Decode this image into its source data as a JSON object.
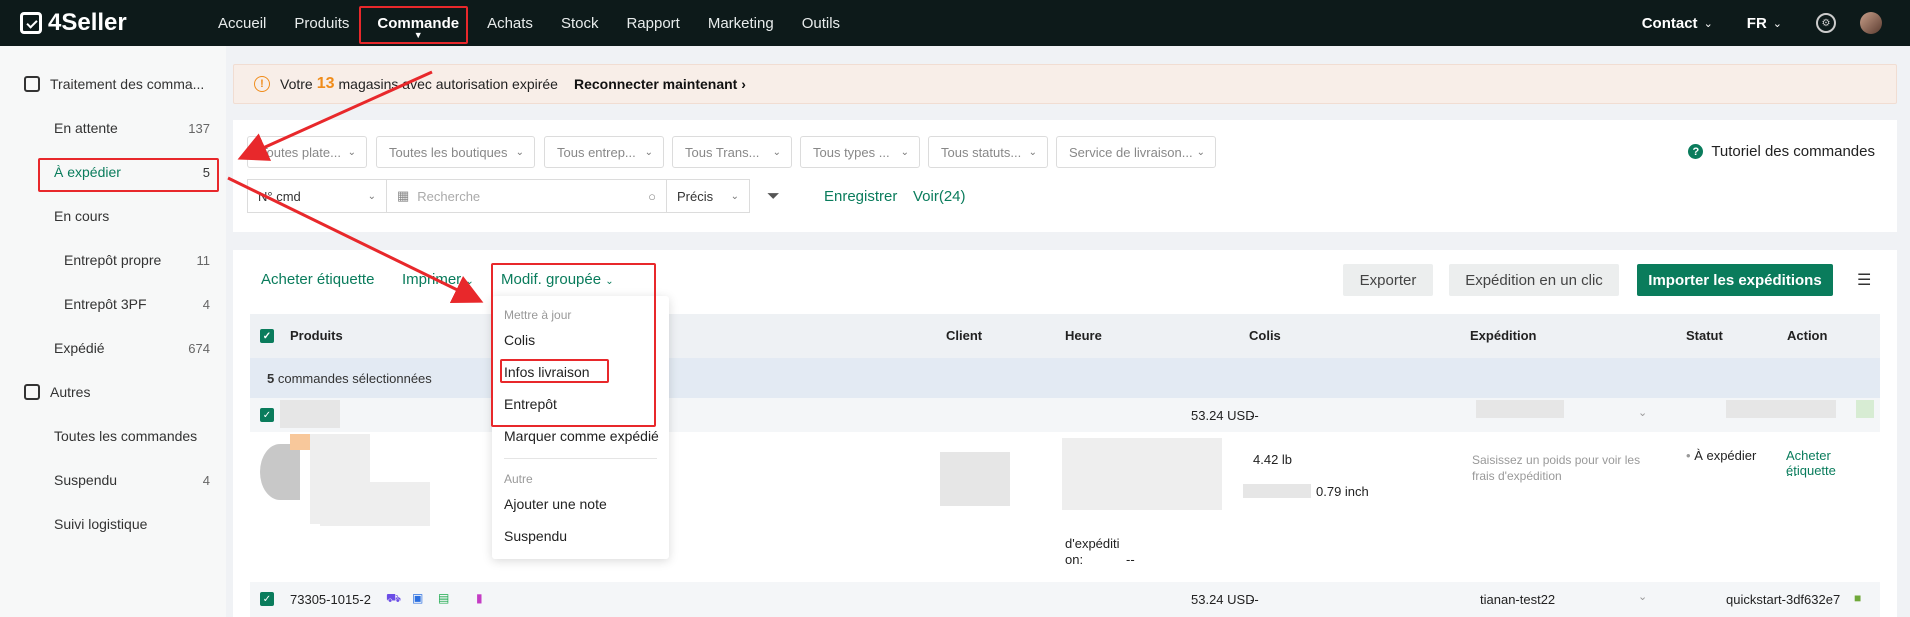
{
  "brand": "4Seller",
  "nav": {
    "items": [
      "Accueil",
      "Produits",
      "Commande",
      "Achats",
      "Stock",
      "Rapport",
      "Marketing",
      "Outils"
    ],
    "active_caret": "⌄",
    "contact": "Contact",
    "lang": "FR"
  },
  "sidebar": {
    "section1": "Traitement des comma...",
    "items": [
      {
        "label": "En attente",
        "count": "137"
      },
      {
        "label": "À expédier",
        "count": "5"
      },
      {
        "label": "En cours",
        "count": ""
      },
      {
        "label": "Entrepôt propre",
        "count": "11"
      },
      {
        "label": "Entrepôt 3PF",
        "count": "4"
      },
      {
        "label": "Expédié",
        "count": "674"
      }
    ],
    "section2": "Autres",
    "items2": [
      {
        "label": "Toutes les commandes",
        "count": ""
      },
      {
        "label": "Suspendu",
        "count": "4"
      },
      {
        "label": "Suivi logistique",
        "count": ""
      }
    ]
  },
  "banner": {
    "prefix": "Votre",
    "count": "13",
    "suffix": "magasins avec autorisation expirée",
    "link": "Reconnecter maintenant",
    "link_arrow": "›"
  },
  "filters": {
    "dropdowns": [
      "Toutes plate...",
      "Toutes les boutiques",
      "Tous entrep...",
      "Tous Trans...",
      "Tous types ...",
      "Tous statuts...",
      "Service de livraison..."
    ],
    "field_select": "N° cmd",
    "search_placeholder": "Recherche",
    "match_select": "Précis",
    "save": "Enregistrer",
    "view": "Voir(24)",
    "tutorial": "Tutoriel des commandes"
  },
  "toolbar": {
    "buy_label": "Acheter étiquette",
    "print": "Imprimer",
    "bulk_edit": "Modif. groupée",
    "export": "Exporter",
    "one_click": "Expédition en un clic",
    "import": "Importer les expéditions"
  },
  "table": {
    "headers": [
      "Produits",
      "Client",
      "Heure",
      "Colis",
      "Expédition",
      "Statut",
      "Action"
    ],
    "selected_text_count": "5",
    "selected_text": "commandes sélectionnées",
    "row1": {
      "amount": "53.24 USD",
      "colis": "--",
      "weight": "4.42 lb",
      "dims": "0.79 inch",
      "ship_hint": "Saisissez un poids pour voir les frais d'expédition",
      "status": "À expédier",
      "action": "Acheter étiquette",
      "action_more": "...",
      "ship_time_label": "d'expéditi",
      "ship_time_on": "on:",
      "ship_time_val": "--"
    },
    "row2": {
      "order_no": "73305-1015-2",
      "amount": "53.24 USD",
      "colis": "--",
      "shipping": "tianan-test22",
      "store": "quickstart-3df632e7"
    }
  },
  "menu": {
    "group1": "Mettre à jour",
    "items1": [
      "Colis",
      "Infos livraison",
      "Entrepôt"
    ],
    "mark_shipped": "Marquer comme expédié",
    "group2": "Autre",
    "items2": [
      "Ajouter une note",
      "Suspendu"
    ]
  },
  "colors": {
    "accent": "#0a7c5c",
    "nav_bg": "#0d1a1a",
    "annotation": "#e8282b",
    "warning": "#f08c1a"
  }
}
